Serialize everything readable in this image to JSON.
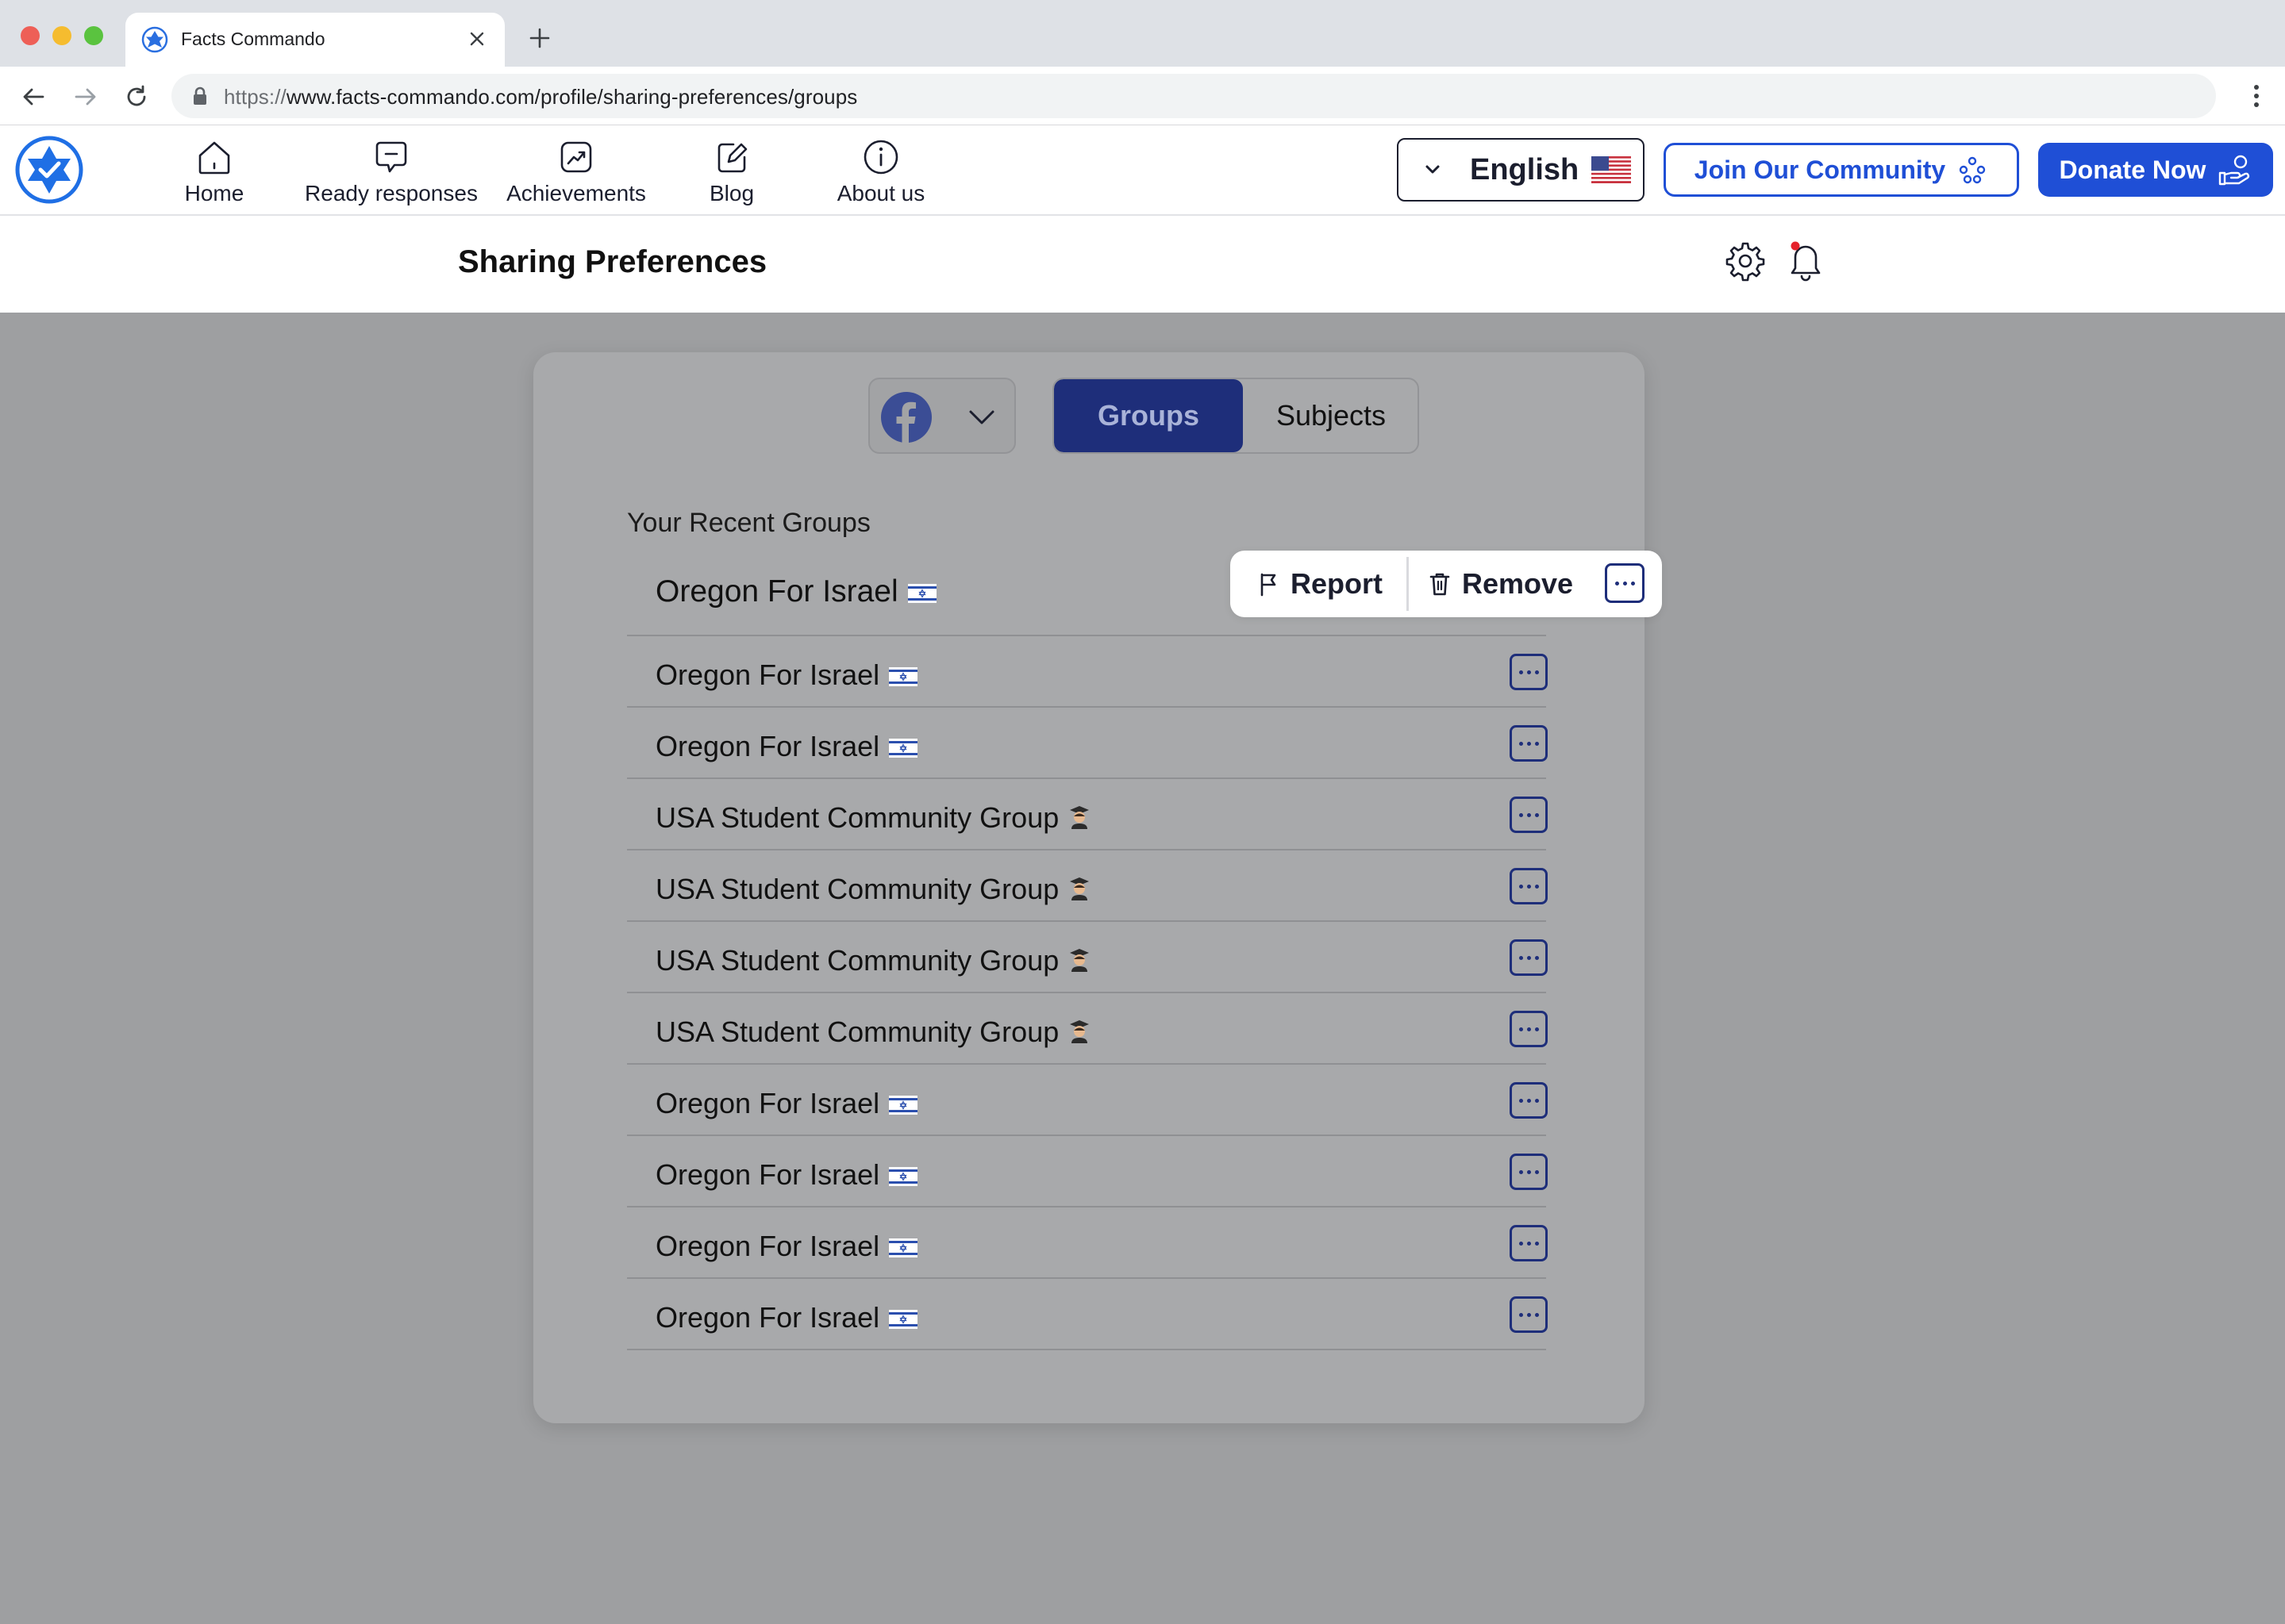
{
  "browser": {
    "tab_title": "Facts Commando",
    "url_scheme": "https://",
    "url_rest": "www.facts-commando.com/profile/sharing-preferences/groups"
  },
  "nav": {
    "items": [
      {
        "label": "Home",
        "icon": "home-icon"
      },
      {
        "label": "Ready responses",
        "icon": "chat-minus-icon"
      },
      {
        "label": "Achievements",
        "icon": "trend-chart-icon"
      },
      {
        "label": "Blog",
        "icon": "edit-icon"
      },
      {
        "label": "About us",
        "icon": "info-icon"
      }
    ],
    "language": "English",
    "join_label": "Join Our Community",
    "donate_label": "Donate Now"
  },
  "page": {
    "title": "Sharing Preferences"
  },
  "tabs": {
    "groups": "Groups",
    "subjects": "Subjects",
    "active": "Groups",
    "platform": "facebook"
  },
  "recent": {
    "title": "Your Recent Groups",
    "groups": [
      {
        "name": "Oregon For Israel",
        "emoji": "israel-flag"
      },
      {
        "name": "Oregon For Israel",
        "emoji": "israel-flag"
      },
      {
        "name": "Oregon For Israel",
        "emoji": "israel-flag"
      },
      {
        "name": "USA Student Community Group",
        "emoji": "student"
      },
      {
        "name": "USA Student Community Group",
        "emoji": "student"
      },
      {
        "name": "USA Student Community Group",
        "emoji": "student"
      },
      {
        "name": "USA Student Community Group",
        "emoji": "student"
      },
      {
        "name": "Oregon For Israel",
        "emoji": "israel-flag"
      },
      {
        "name": "Oregon For Israel",
        "emoji": "israel-flag"
      },
      {
        "name": "Oregon For Israel",
        "emoji": "israel-flag"
      },
      {
        "name": "Oregon For Israel",
        "emoji": "israel-flag"
      }
    ]
  },
  "popover": {
    "report_label": "Report",
    "remove_label": "Remove"
  },
  "colors": {
    "brand_blue": "#1f4fd6",
    "navy": "#1e2e7a",
    "overlay_gray": "#9e9fa1"
  }
}
